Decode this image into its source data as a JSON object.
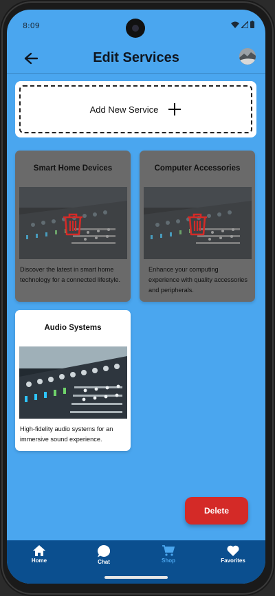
{
  "status_bar": {
    "time": "8:09"
  },
  "header": {
    "title": "Edit Services"
  },
  "add_service": {
    "label": "Add New Service"
  },
  "services": [
    {
      "title": "Smart Home Devices",
      "description": "Discover the latest in smart home technology for a connected lifestyle.",
      "marked_for_delete": true
    },
    {
      "title": "Computer Accessories",
      "description": "Enhance your computing experience with quality accessories and peripherals.",
      "marked_for_delete": true
    },
    {
      "title": "Audio Systems",
      "description": "High-fidelity audio systems for an immersive sound experience.",
      "marked_for_delete": false
    }
  ],
  "delete_button": {
    "label": "Delete"
  },
  "bottom_nav": {
    "items": [
      {
        "label": "Home",
        "icon": "home-icon"
      },
      {
        "label": "Chat",
        "icon": "chat-icon"
      },
      {
        "label": "Shop",
        "icon": "cart-icon",
        "active": true
      },
      {
        "label": "Favorites",
        "icon": "heart-icon"
      }
    ]
  },
  "colors": {
    "background": "#4aa6ef",
    "nav": "#0b4f8f",
    "delete": "#d42a27",
    "trash": "#d42a27",
    "dim_card": "#6a6a6a"
  }
}
